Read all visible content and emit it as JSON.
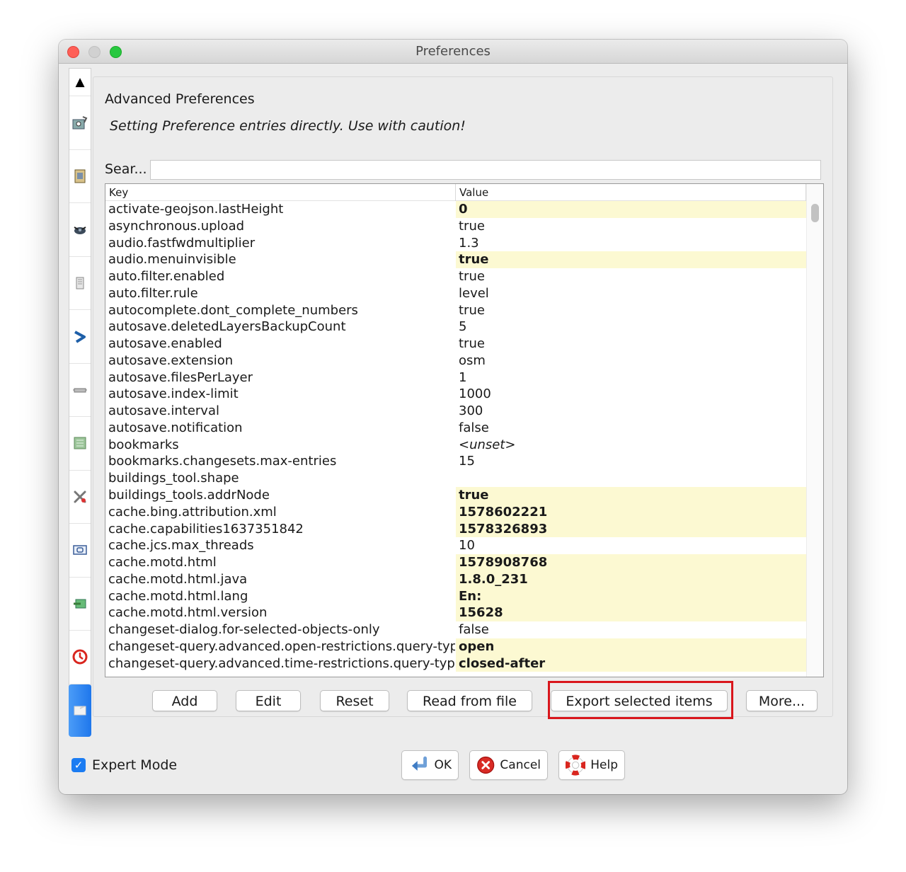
{
  "window": {
    "title": "Preferences"
  },
  "tabs": {
    "items": [
      {
        "icon": "map-settings-icon"
      },
      {
        "icon": "display-icon"
      },
      {
        "icon": "satellite-icon"
      },
      {
        "icon": "drawing-icon"
      },
      {
        "icon": "connection-icon"
      },
      {
        "icon": "plugin-icon"
      },
      {
        "icon": "presets-icon"
      },
      {
        "icon": "shortcuts-icon"
      },
      {
        "icon": "remote-control-icon"
      },
      {
        "icon": "validator-icon"
      },
      {
        "icon": "audio-icon"
      },
      {
        "icon": "advanced-preferences-icon",
        "active": true
      }
    ]
  },
  "panel": {
    "heading": "Advanced Preferences",
    "warning": "Setting Preference entries directly. Use with caution!",
    "search_label": "Sear...",
    "search_value": ""
  },
  "table": {
    "columns": {
      "key": "Key",
      "value": "Value"
    },
    "rows": [
      {
        "key": "activate-geojson.lastHeight",
        "value": "0",
        "modified": true
      },
      {
        "key": "asynchronous.upload",
        "value": "true"
      },
      {
        "key": "audio.fastfwdmultiplier",
        "value": "1.3"
      },
      {
        "key": "audio.menuinvisible",
        "value": "true",
        "modified": true
      },
      {
        "key": "auto.filter.enabled",
        "value": "true"
      },
      {
        "key": "auto.filter.rule",
        "value": "level"
      },
      {
        "key": "autocomplete.dont_complete_numbers",
        "value": "true"
      },
      {
        "key": "autosave.deletedLayersBackupCount",
        "value": "5"
      },
      {
        "key": "autosave.enabled",
        "value": "true"
      },
      {
        "key": "autosave.extension",
        "value": "osm"
      },
      {
        "key": "autosave.filesPerLayer",
        "value": "1"
      },
      {
        "key": "autosave.index-limit",
        "value": "1000"
      },
      {
        "key": "autosave.interval",
        "value": "300"
      },
      {
        "key": "autosave.notification",
        "value": "false"
      },
      {
        "key": "bookmarks",
        "value": "<unset>",
        "unset": true
      },
      {
        "key": "bookmarks.changesets.max-entries",
        "value": "15"
      },
      {
        "key": "buildings_tool.shape",
        "value": ""
      },
      {
        "key": "buildings_tools.addrNode",
        "value": "true",
        "modified": true
      },
      {
        "key": "cache.bing.attribution.xml",
        "value": "1578602221",
        "modified": true
      },
      {
        "key": "cache.capabilities1637351842",
        "value": "1578326893",
        "modified": true
      },
      {
        "key": "cache.jcs.max_threads",
        "value": "10"
      },
      {
        "key": "cache.motd.html",
        "value": "1578908768",
        "modified": true
      },
      {
        "key": "cache.motd.html.java",
        "value": "1.8.0_231",
        "modified": true
      },
      {
        "key": "cache.motd.html.lang",
        "value": "En:",
        "modified": true
      },
      {
        "key": "cache.motd.html.version",
        "value": "15628",
        "modified": true
      },
      {
        "key": "changeset-dialog.for-selected-objects-only",
        "value": "false"
      },
      {
        "key": "changeset-query.advanced.open-restrictions.query-type",
        "value": "open",
        "modified": true
      },
      {
        "key": "changeset-query.advanced.time-restrictions.query-type",
        "value": "closed-after",
        "modified": true
      }
    ]
  },
  "buttons": {
    "add": "Add",
    "edit": "Edit",
    "reset": "Reset",
    "read_from_file": "Read from file",
    "export_selected": "Export selected items",
    "more": "More..."
  },
  "footer": {
    "expert_mode_label": "Expert Mode",
    "expert_mode_checked": true,
    "ok": "OK",
    "cancel": "Cancel",
    "help": "Help"
  },
  "colors": {
    "modified_row_bg": "#fcf9d2",
    "highlight_box": "#d9161c",
    "active_tab": "#1f77ec"
  }
}
